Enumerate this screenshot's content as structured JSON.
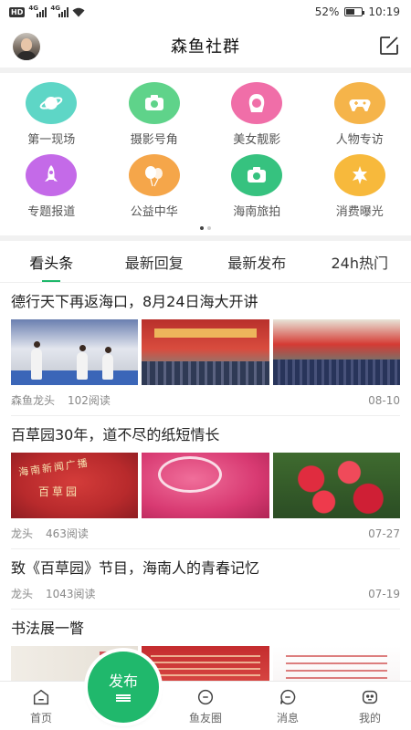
{
  "status_bar": {
    "hd": "HD",
    "sig1": "4G",
    "sig2": "4G",
    "battery_percent": "52%",
    "battery_level": 0.52,
    "time": "10:19"
  },
  "header": {
    "title": "森鱼社群"
  },
  "categories": [
    {
      "label": "第一现场",
      "icon": "planet-icon",
      "color": "#5ed6c6"
    },
    {
      "label": "摄影号角",
      "icon": "camera-icon",
      "color": "#5fd38a"
    },
    {
      "label": "美女靓影",
      "icon": "woman-icon",
      "color": "#f06ea8"
    },
    {
      "label": "人物专访",
      "icon": "gamepad-icon",
      "color": "#f5b44a"
    },
    {
      "label": "专题报道",
      "icon": "rocket-icon",
      "color": "#c46ae8"
    },
    {
      "label": "公益中华",
      "icon": "balloons-icon",
      "color": "#f5a64a"
    },
    {
      "label": "海南旅拍",
      "icon": "camera-icon",
      "color": "#36c27f"
    },
    {
      "label": "消费曝光",
      "icon": "puzzle-icon",
      "color": "#f7b93c"
    }
  ],
  "tabs": [
    {
      "label": "看头条",
      "active": true
    },
    {
      "label": "最新回复",
      "active": false
    },
    {
      "label": "最新发布",
      "active": false
    },
    {
      "label": "24h热门",
      "active": false
    }
  ],
  "posts": [
    {
      "title": "德行天下再返海口，8月24日海大开讲",
      "author": "森鱼龙头",
      "reads": "102阅读",
      "date": "08-10"
    },
    {
      "title": "百草园30年，道不尽的纸短情长",
      "author": "龙头",
      "reads": "463阅读",
      "date": "07-27"
    },
    {
      "title": "致《百草园》节目，海南人的青春记忆",
      "author": "龙头",
      "reads": "1043阅读",
      "date": "07-19"
    },
    {
      "title": "书法展一瞥"
    }
  ],
  "thumb_text": {
    "banner1": "海南新闻广播",
    "banner2": "百草园"
  },
  "bottom_nav": {
    "home": "首页",
    "publish": "发布",
    "circle": "鱼友圈",
    "messages": "消息",
    "mine": "我的"
  },
  "colors": {
    "accent": "#20b86c",
    "tab_underline": "#1fb86b"
  }
}
